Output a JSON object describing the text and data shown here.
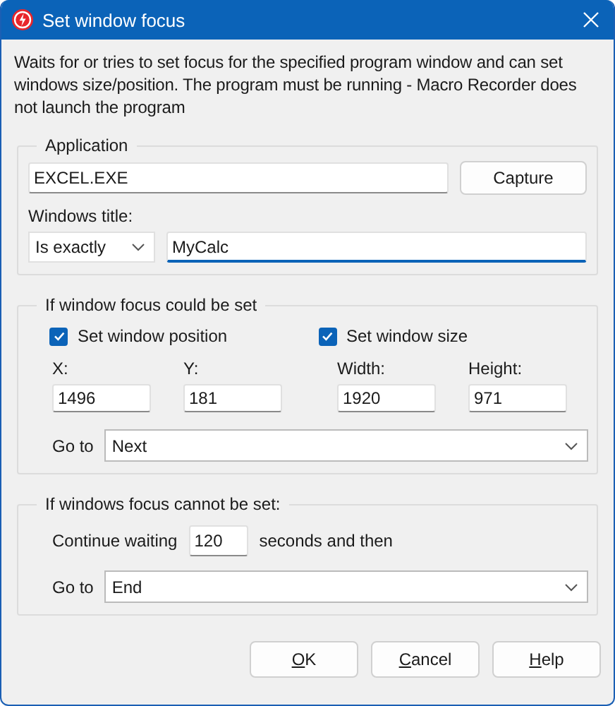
{
  "window": {
    "title": "Set window focus"
  },
  "description": "Waits for or tries to set focus for the specified program window and can set windows size/position. The program must be running - Macro Recorder does not launch the program",
  "application": {
    "legend": "Application",
    "program": "EXCEL.EXE",
    "capture_button": "Capture",
    "title_label": "Windows title:",
    "match_mode": "Is exactly",
    "title_value": "MyCalc"
  },
  "on_success": {
    "legend": "If window focus could be set",
    "checkboxes": [
      {
        "label": "Set window position",
        "checked": true
      },
      {
        "label": "Set window size",
        "checked": true
      }
    ],
    "fields": [
      {
        "label": "X:",
        "value": "1496"
      },
      {
        "label": "Y:",
        "value": "181"
      },
      {
        "label": "Width:",
        "value": "1920"
      },
      {
        "label": "Height:",
        "value": "971"
      }
    ],
    "goto_label": "Go to",
    "goto_value": "Next"
  },
  "on_failure": {
    "legend": "If windows focus cannot be set:",
    "wait_label": "Continue waiting",
    "wait_value": "120",
    "wait_suffix": "seconds and then",
    "goto_label": "Go to",
    "goto_value": "End"
  },
  "buttons": [
    "OK",
    "Cancel",
    "Help"
  ]
}
